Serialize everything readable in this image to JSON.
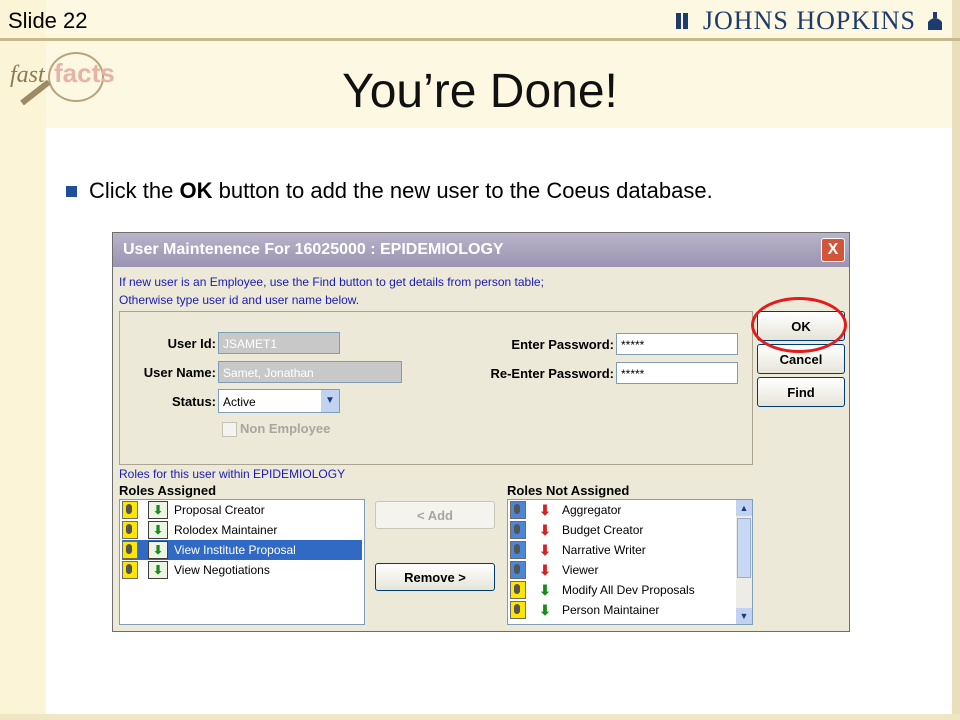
{
  "slide": {
    "number_label": "Slide 22",
    "logo_text": "JOHNS HOPKINS",
    "brand_fast": "fast",
    "brand_facts": "facts",
    "title": "You’re Done!",
    "bullet": {
      "prefix": "Click the ",
      "bold": "OK",
      "suffix": " button to add the new user to the Coeus database."
    }
  },
  "dialog": {
    "title": "User Maintenence For 16025000 : EPIDEMIOLOGY",
    "close_label": "X",
    "note_line1": "If new user is an Employee, use the Find button to get details from person table;",
    "note_line2": "Otherwise type user id and user name below.",
    "form": {
      "user_id_label": "User Id:",
      "user_id_value": "JSAMET1",
      "user_name_label": "User Name:",
      "user_name_value": "Samet, Jonathan",
      "status_label": "Status:",
      "status_value": "Active",
      "non_employee_label": "Non Employee",
      "enter_password_label": "Enter Password:",
      "enter_password_value": "*****",
      "reenter_password_label": "Re-Enter Password:",
      "reenter_password_value": "*****"
    },
    "buttons": {
      "ok": "OK",
      "cancel": "Cancel",
      "find": "Find",
      "add": "< Add",
      "remove": "Remove >"
    },
    "roles_heading": "Roles for this user within EPIDEMIOLOGY",
    "roles_assigned_label": "Roles Assigned",
    "roles_not_assigned_label": "Roles Not Assigned",
    "roles_assigned": [
      {
        "label": "Proposal Creator",
        "selected": false
      },
      {
        "label": "Rolodex Maintainer",
        "selected": false
      },
      {
        "label": "View Institute Proposal",
        "selected": true
      },
      {
        "label": "View Negotiations",
        "selected": false
      }
    ],
    "roles_not_assigned": [
      {
        "label": "Aggregator",
        "arrow": "red"
      },
      {
        "label": "Budget Creator",
        "arrow": "red"
      },
      {
        "label": "Narrative Writer",
        "arrow": "red"
      },
      {
        "label": "Viewer",
        "arrow": "red"
      },
      {
        "label": "Modify All Dev Proposals",
        "arrow": "green"
      },
      {
        "label": "Person Maintainer",
        "arrow": "green"
      }
    ],
    "colors": {
      "highlight_ring": "#e21c1c",
      "selection": "#316ac5",
      "note_text": "#1a1ab8"
    }
  }
}
